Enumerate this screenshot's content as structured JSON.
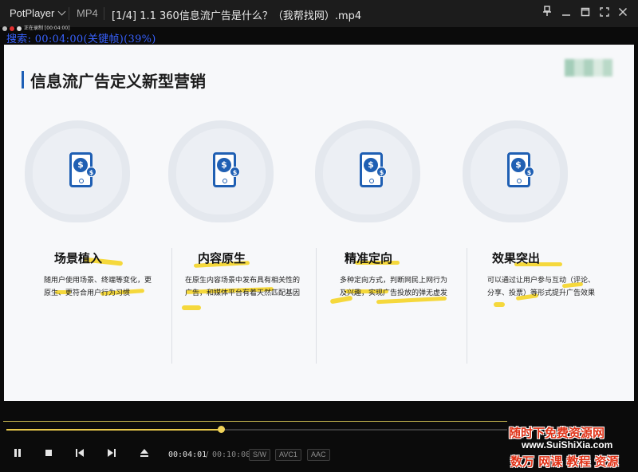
{
  "titlebar": {
    "app_name": "PotPlayer",
    "format": "MP4",
    "video_title": "[1/4] 1.1 360信息流广告是什么？（我帮找网）.mp4",
    "buttons": [
      "pin-icon",
      "minimize-icon",
      "maximize-icon",
      "fullscreen-icon",
      "close-icon"
    ]
  },
  "capture": {
    "text": "正在录制 [00:04:00]"
  },
  "osd": {
    "text": "搜索: 00:04:00(关键帧)(39%)"
  },
  "slide": {
    "title": "信息流广告定义新型营销",
    "columns": [
      {
        "heading": "场景植入",
        "lines": [
          "随用户使用场景、终端等变化，更",
          "原生、更符合用户行为习惯"
        ]
      },
      {
        "heading": "内容原生",
        "lines": [
          "在原生内容场景中发布具有相关性的",
          "广告，和媒体平台有着天然匹配基因"
        ]
      },
      {
        "heading": "精准定向",
        "lines": [
          "多种定向方式，判断网民上网行为",
          "及兴趣，实现广告投放的弹无虚发"
        ]
      },
      {
        "heading": "效果突出",
        "lines": [
          "可以通过让用户参与互动（评论、",
          "分享、投票）等形式提升广告效果"
        ]
      }
    ]
  },
  "player": {
    "progress": 0.39,
    "time_current": "00:04:01",
    "time_separator": "/",
    "time_total": "00:10:08",
    "tags": [
      "S/W",
      "AVC1",
      "AAC"
    ],
    "controls": [
      "pause-icon",
      "stop-icon",
      "previous-icon",
      "next-icon",
      "eject-icon"
    ]
  },
  "watermark": {
    "line1": "随时下免费资源网",
    "line2": "www.SuiShiXia.com",
    "line3": "数万 网课 教程 资源"
  }
}
